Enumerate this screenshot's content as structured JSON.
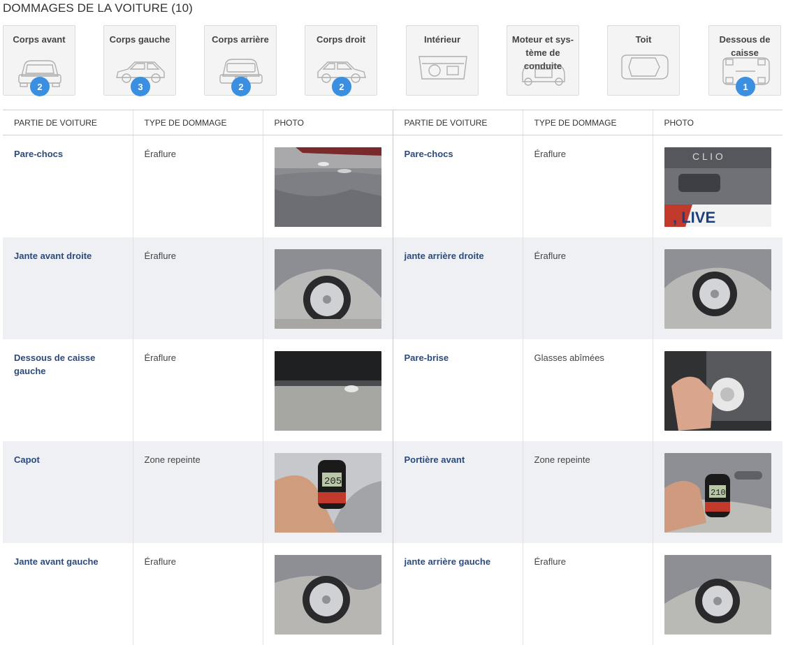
{
  "page_title": "DOMMAGES DE LA VOITURE (10)",
  "categories": [
    {
      "label": "Corps avant",
      "count": "2",
      "icon": "car-front-icon"
    },
    {
      "label": "Corps gauche",
      "count": "3",
      "icon": "car-side-icon"
    },
    {
      "label": "Corps arrière",
      "count": "2",
      "icon": "car-rear-icon"
    },
    {
      "label": "Corps droit",
      "count": "2",
      "icon": "car-side-icon"
    },
    {
      "label": "Intérieur",
      "count": "",
      "icon": "car-interior-icon"
    },
    {
      "label": "Moteur et sys-tème de conduite",
      "count": "",
      "icon": "engine-icon"
    },
    {
      "label": "Toit",
      "count": "",
      "icon": "car-top-icon"
    },
    {
      "label": "Dessous de caisse",
      "count": "1",
      "icon": "car-underbody-icon"
    }
  ],
  "table": {
    "headers": [
      "PARTIE DE VOITURE",
      "TYPE DE DOMMAGE",
      "PHOTO",
      "PARTIE DE VOITURE",
      "TYPE DE DOMMAGE",
      "PHOTO"
    ],
    "rows": [
      {
        "left": {
          "part": "Pare-chocs",
          "damage": "Éraflure"
        },
        "right": {
          "part": "Pare-chocs",
          "damage": "Éraflure"
        }
      },
      {
        "left": {
          "part": "Jante avant droite",
          "damage": "Éraflure"
        },
        "right": {
          "part": "jante arrière droite",
          "damage": "Éraflure"
        }
      },
      {
        "left": {
          "part": "Dessous de caisse gauche",
          "damage": "Éraflure"
        },
        "right": {
          "part": "Pare-brise",
          "damage": "Glasses abîmées"
        }
      },
      {
        "left": {
          "part": "Capot",
          "damage": "Zone repeinte"
        },
        "right": {
          "part": "Portière avant",
          "damage": "Zone repeinte"
        }
      },
      {
        "left": {
          "part": "Jante avant gauche",
          "damage": "Éraflure"
        },
        "right": {
          "part": "jante arrière gauche",
          "damage": "Éraflure"
        }
      }
    ]
  },
  "photo_texts": {
    "clio_logo": "C L I O",
    "plate_text": ", LIVE",
    "gauge_left": "205",
    "gauge_right": "210"
  },
  "colors": {
    "accent": "#3b8fe0",
    "part_text": "#2c4a7a",
    "row_alt": "#eef0f4"
  }
}
